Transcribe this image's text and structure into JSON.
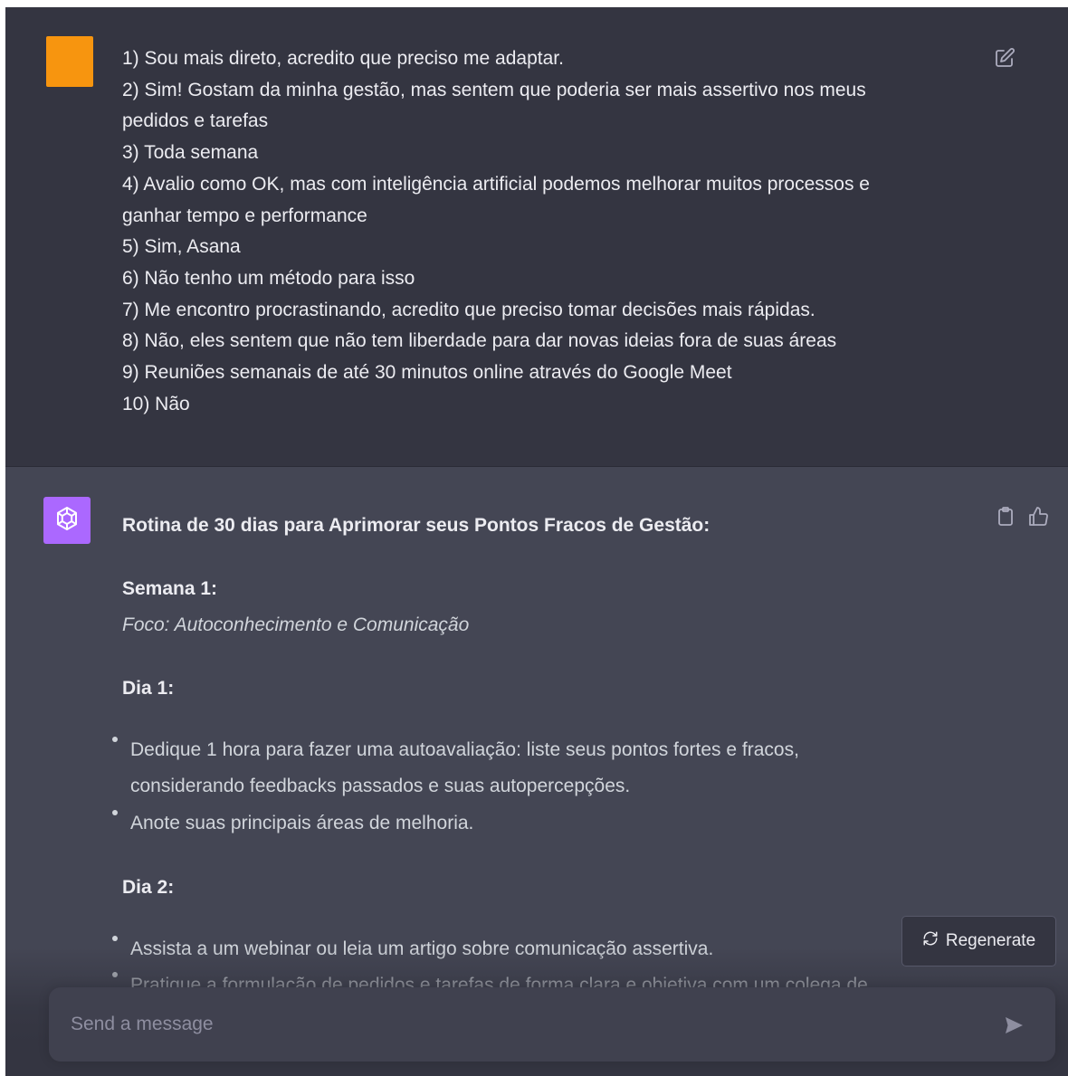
{
  "user_message": {
    "lines": [
      "1) Sou mais direto, acredito que preciso me adaptar.",
      "2) Sim! Gostam da minha gestão, mas sentem que poderia ser mais assertivo nos meus",
      "pedidos e tarefas",
      "3) Toda semana",
      "4) Avalio como OK, mas com inteligência artificial podemos melhorar muitos processos e",
      "ganhar tempo e performance",
      "5) Sim, Asana",
      "6) Não tenho um método para isso",
      "7) Me encontro procrastinando, acredito que preciso tomar decisões mais rápidas.",
      "8) Não, eles sentem que não tem liberdade para dar novas ideias fora de suas áreas",
      "9) Reuniões semanais de até 30 minutos online através do Google Meet",
      "10) Não"
    ]
  },
  "assistant_message": {
    "title": "Rotina de 30 dias para Aprimorar seus Pontos Fracos de Gestão:",
    "week1_heading": "Semana 1:",
    "week1_focus": "Foco: Autoconhecimento e Comunicação",
    "day1_heading": "Dia 1:",
    "day1_items": [
      "Dedique 1 hora para fazer uma autoavaliação: liste seus pontos fortes e fracos,",
      "considerando feedbacks passados e suas autopercepções.",
      "Anote suas principais áreas de melhoria."
    ],
    "day2_heading": "Dia 2:",
    "day2_items": [
      "Assista a um webinar ou leia um artigo sobre comunicação assertiva.",
      "Pratique a formulação de pedidos e tarefas de forma clara e objetiva com um colega de"
    ]
  },
  "regenerate_label": "Regenerate",
  "composer": {
    "placeholder": "Send a message"
  },
  "colors": {
    "user_bg": "#343541",
    "assistant_bg": "#444654",
    "user_avatar": "#f7950f",
    "assistant_avatar": "#ab68ff"
  },
  "icons": [
    "edit-icon",
    "openai-logo-icon",
    "copy-icon",
    "thumbs-up-icon",
    "regenerate-icon",
    "send-icon"
  ]
}
